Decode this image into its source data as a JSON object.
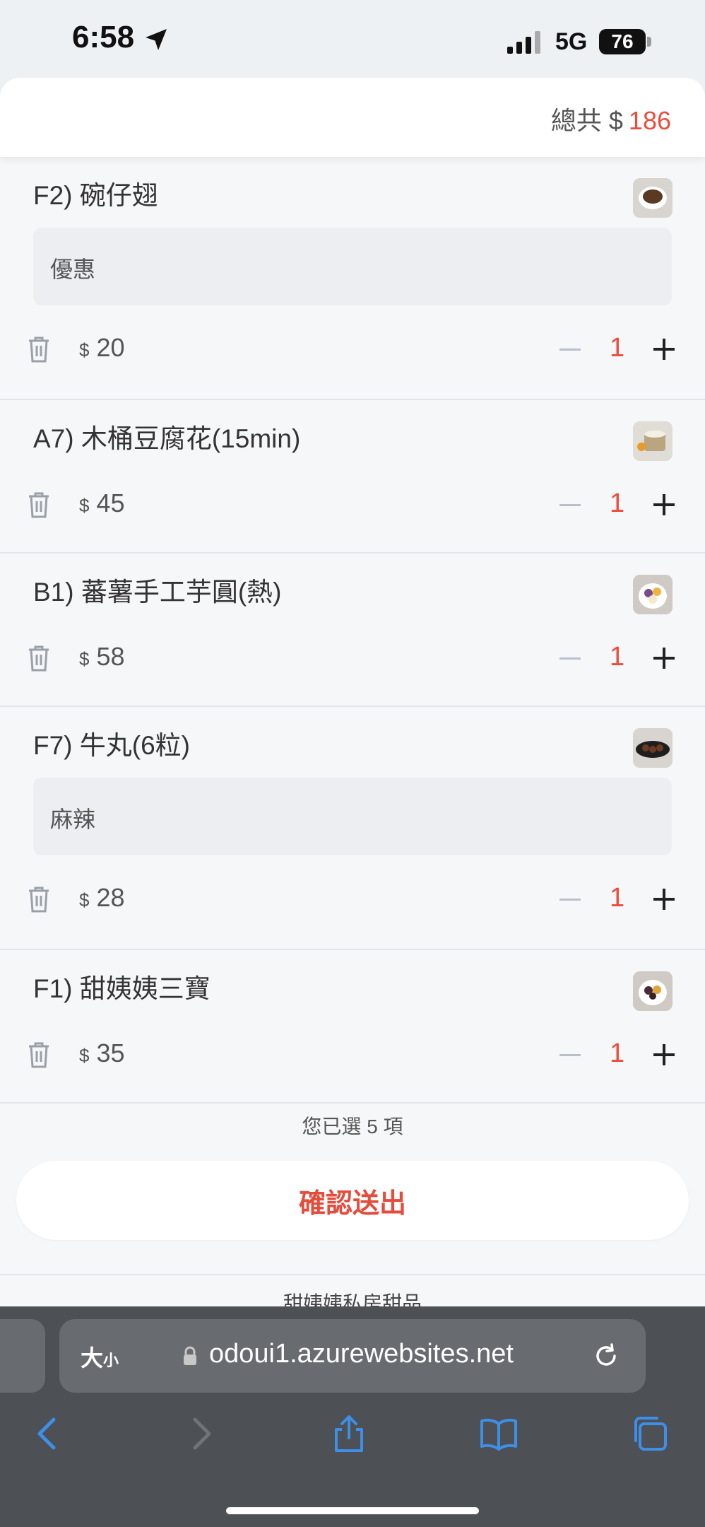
{
  "status_bar": {
    "time": "6:58",
    "network": "5G",
    "battery": "76"
  },
  "order": {
    "total_label": "總共 $",
    "total_amount": "186",
    "currency_symbol": "$",
    "items": [
      {
        "name": "F2) 碗仔翅",
        "note": "優惠",
        "price": "20",
        "qty": "1"
      },
      {
        "name": "A7) 木桶豆腐花(15min)",
        "note": "",
        "price": "45",
        "qty": "1"
      },
      {
        "name": "B1) 蕃薯手工芋圓(熱)",
        "note": "",
        "price": "58",
        "qty": "1"
      },
      {
        "name": "F7) 牛丸(6粒)",
        "note": "麻辣",
        "price": "28",
        "qty": "1"
      },
      {
        "name": "F1) 甜姨姨三寶",
        "note": "",
        "price": "35",
        "qty": "1"
      }
    ],
    "selected_count_text": "您已選 5 項",
    "submit_label": "確認送出",
    "footer_text": "甜姨姨私房甜品"
  },
  "browser": {
    "text_size_label": "大",
    "text_size_small": "小",
    "url": "odoui1.azurewebsites.net"
  },
  "colors": {
    "accent": "#ee4b3b",
    "toolbar_bg": "#4d5054",
    "nav_blue": "#3d8fe8"
  }
}
